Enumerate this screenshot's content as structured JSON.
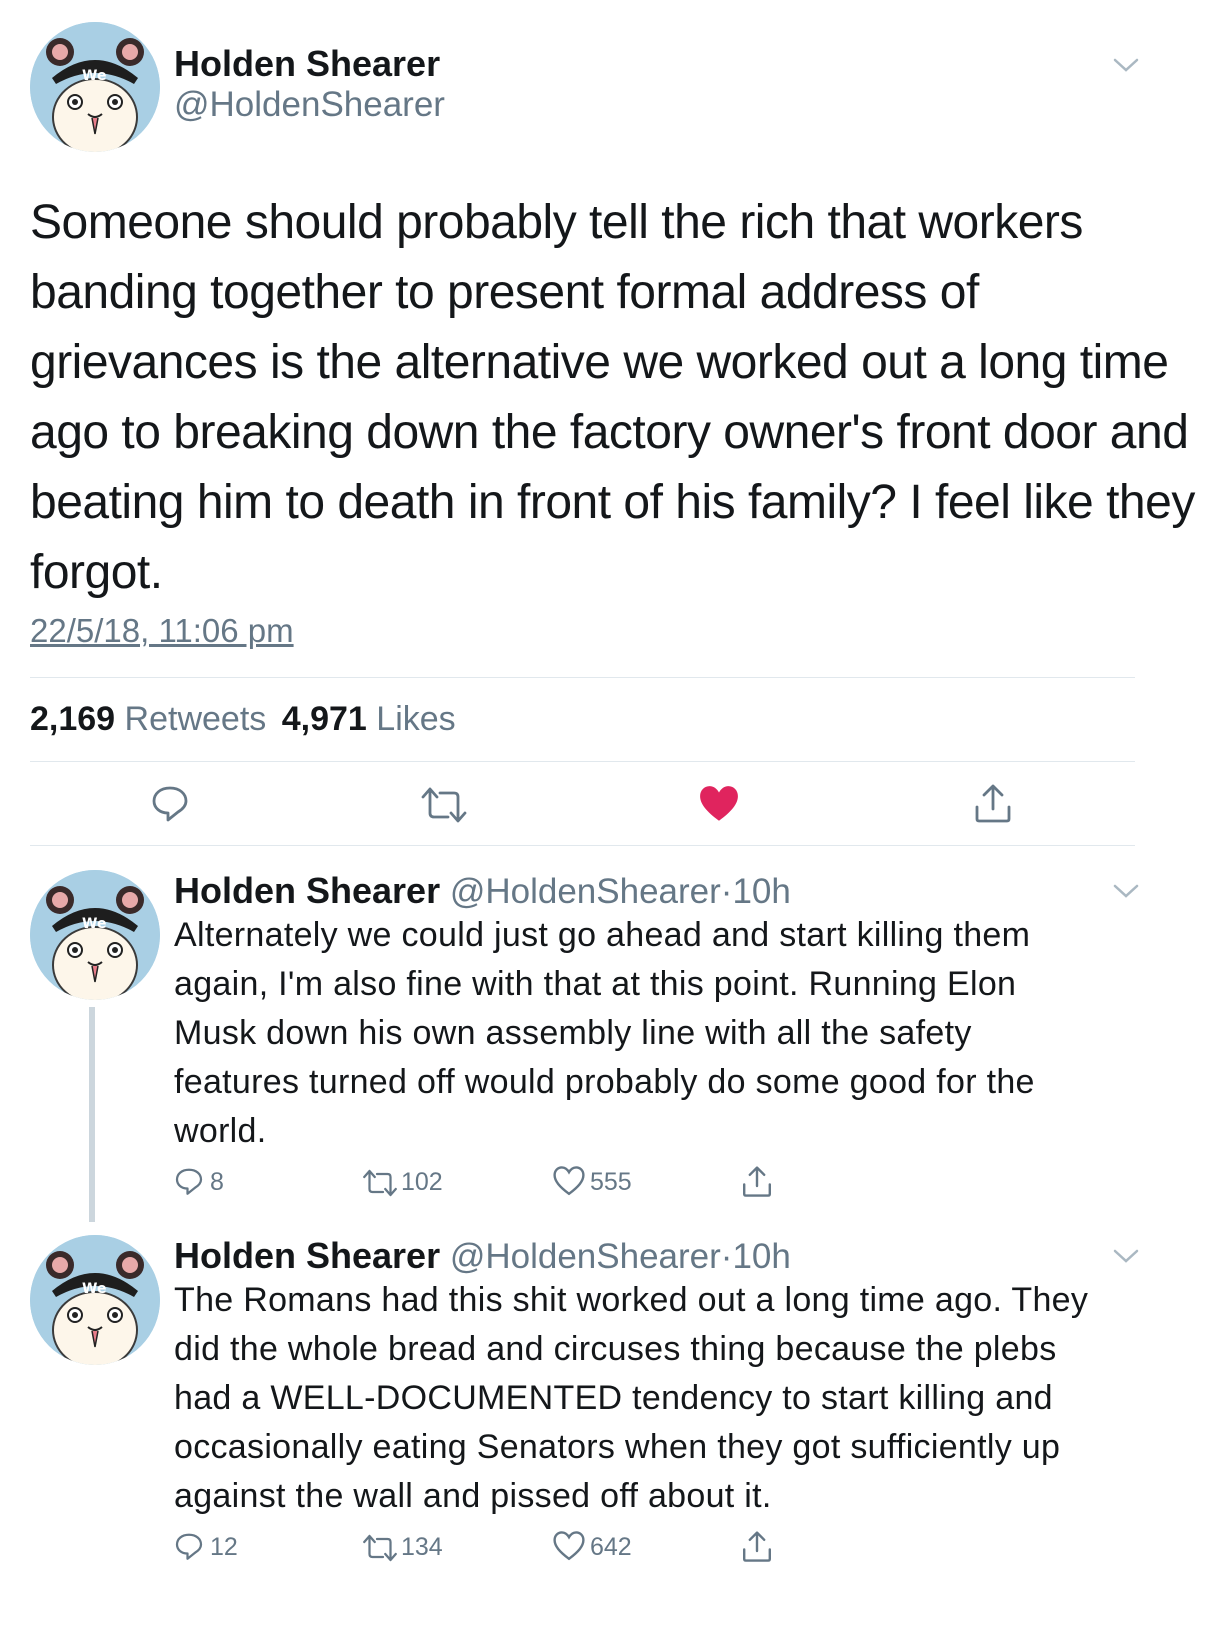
{
  "main_tweet": {
    "name": "Holden Shearer",
    "handle": "@HoldenShearer",
    "text_lines": [
      "Someone should probably tell the rich that workers",
      "banding together to present formal address of",
      "grievances is the alternative we worked out a long time",
      "ago to breaking down the factory owner's front door and",
      "beating him to death in front of his family? I feel like they",
      "forgot."
    ],
    "timestamp": "22/5/18, 11:06 pm",
    "retweets_count": "2,169",
    "retweets_label": "Retweets",
    "likes_count": "4,971",
    "likes_label": "Likes",
    "liked": true
  },
  "replies": [
    {
      "name": "Holden Shearer",
      "handle": "@HoldenShearer",
      "separator": "·",
      "time": "10h",
      "text_lines": [
        "Alternately we could just go ahead and start killing them",
        "again, I'm also fine with that at this point. Running Elon",
        "Musk down his own assembly line with all the safety",
        "features turned off would probably do some good for the",
        "world."
      ],
      "reply_count": "8",
      "retweet_count": "102",
      "like_count": "555"
    },
    {
      "name": "Holden Shearer",
      "handle": "@HoldenShearer",
      "separator": "·",
      "time": "10h",
      "text_lines": [
        "The Romans had this shit worked out a long time ago. They",
        "did the whole bread and circuses thing because the plebs",
        "had a WELL-DOCUMENTED tendency to start killing and",
        "occasionally eating Senators when they got sufficiently up",
        "against the wall and pissed off about it."
      ],
      "reply_count": "12",
      "retweet_count": "134",
      "like_count": "642"
    }
  ],
  "icons": {
    "reply": "reply-icon",
    "retweet": "retweet-icon",
    "like": "heart-icon",
    "share": "share-icon",
    "caret": "chevron-down-icon"
  },
  "colors": {
    "like_red": "#e0245e",
    "secondary_text": "#657786",
    "divider": "#e1e8ed",
    "avatar_bg": "#a9cfe4"
  }
}
